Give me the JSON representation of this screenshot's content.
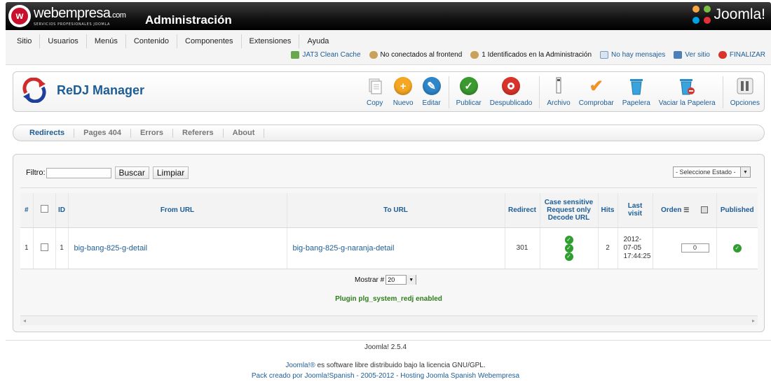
{
  "header": {
    "brand_name": "webempresa",
    "brand_tld": ".com",
    "brand_sub": "SERVICIOS PROFESIONALES JOOMLA",
    "title": "Administración",
    "joomla_label": "Joomla!"
  },
  "menu": [
    "Sitio",
    "Usuarios",
    "Menús",
    "Contenido",
    "Componentes",
    "Extensiones",
    "Ayuda"
  ],
  "status": {
    "cache": "JAT3 Clean Cache",
    "frontend": "No conectados al frontend",
    "admin": "1 Identificados en la Administración",
    "messages": "No hay mensajes",
    "site": "Ver sitio",
    "logout": "FINALIZAR"
  },
  "toolbar": {
    "title": "ReDJ Manager",
    "copy": "Copy",
    "new": "Nuevo",
    "edit": "Editar",
    "publish": "Publicar",
    "unpublish": "Despublicado",
    "archive": "Archivo",
    "check": "Comprobar",
    "trash": "Papelera",
    "empty_trash": "Vaciar la Papelera",
    "options": "Opciones"
  },
  "tabs": [
    "Redirects",
    "Pages 404",
    "Errors",
    "Referers",
    "About"
  ],
  "filter": {
    "label": "Filtro:",
    "value": "",
    "search": "Buscar",
    "clear": "Limpiar",
    "state_select": "- Seleccione Estado -"
  },
  "table": {
    "headers": {
      "num": "#",
      "id": "ID",
      "from": "From URL",
      "to": "To URL",
      "redirect": "Redirect",
      "case1": "Case sensitive",
      "case2": "Request only",
      "case3": "Decode URL",
      "hits": "Hits",
      "last1": "Last",
      "last2": "visit",
      "order": "Orden",
      "published": "Published"
    },
    "rows": [
      {
        "num": "1",
        "id": "1",
        "from": "big-bang-825-g-detail",
        "to": "big-bang-825-g-naranja-detail",
        "redirect": "301",
        "hits": "2",
        "last_date1": "2012-",
        "last_date2": "07-05",
        "last_time": "17:44:25",
        "order": "0"
      }
    ]
  },
  "pager": {
    "label": "Mostrar #",
    "value": "20"
  },
  "plugin_message": "Plugin plg_system_redj enabled",
  "footer": {
    "version": "Joomla! 2.5.4",
    "line1_link": "Joomla!®",
    "line1_text": " es software libre distribuido bajo la licencia GNU/GPL.",
    "line2": "Pack creado por Joomla!Spanish - 2005-2012 - Hosting Joomla Spanish Webempresa"
  },
  "colors": {
    "accent": "#1d5d95",
    "success": "#2f9d2f",
    "header_bg": "#000000"
  }
}
